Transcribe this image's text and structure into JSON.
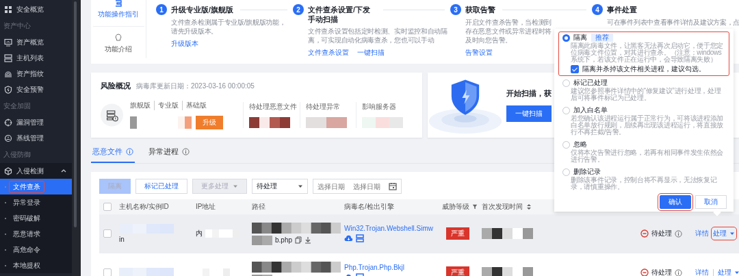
{
  "sidebar": {
    "items": [
      {
        "kind": "item",
        "label": "安全概览",
        "selected": false
      },
      {
        "kind": "section",
        "label": "资产中心"
      },
      {
        "kind": "item",
        "label": "资产概览",
        "selected": false
      },
      {
        "kind": "item",
        "label": "主机列表",
        "selected": false
      },
      {
        "kind": "item",
        "label": "资产指纹",
        "selected": false
      },
      {
        "kind": "item",
        "label": "安全预警",
        "selected": false
      },
      {
        "kind": "section",
        "label": "安全加固"
      },
      {
        "kind": "item",
        "label": "漏洞管理",
        "selected": false
      },
      {
        "kind": "item",
        "label": "基线管理",
        "selected": false
      },
      {
        "kind": "section",
        "label": "入侵防御"
      },
      {
        "kind": "group",
        "label": "入侵检测",
        "expanded": true,
        "children": [
          {
            "label": "文件查杀",
            "selected": true,
            "highlighted": true
          },
          {
            "label": "异常登录",
            "selected": false,
            "highlighted": false
          },
          {
            "label": "密码破解",
            "selected": false,
            "highlighted": false
          },
          {
            "label": "恶意请求",
            "selected": false,
            "highlighted": false
          },
          {
            "label": "高危命令",
            "selected": false,
            "highlighted": false
          },
          {
            "label": "本地提权",
            "selected": false,
            "highlighted": false
          }
        ]
      }
    ]
  },
  "guide": {
    "items": [
      {
        "label": "功能操作指引",
        "selected": true
      },
      {
        "label": "功能介绍",
        "selected": false
      }
    ]
  },
  "steps": [
    {
      "number": "1",
      "title": "升级专业版/旗舰版",
      "description": "文件查杀检测属于专业版/旗舰版功能，请先升级版本。",
      "links": [
        "升级版本"
      ]
    },
    {
      "number": "2",
      "title": "文件查杀设置/下发手动扫描",
      "description": "文件查杀设置包括定时检测、实时监控和自动隔离，可实现自动化病毒查杀，您也可以手动",
      "links": [
        "文件查杀设置",
        "一键扫描"
      ]
    },
    {
      "number": "3",
      "title": "获取告警",
      "description": "开启文件查杀告警，当检测到存在恶意文件或异常进程时将及时向您告警。",
      "links": [
        "告警设置"
      ]
    },
    {
      "number": "4",
      "title": "事件处置",
      "description": "可在事件列表中查看事件详情及建议方案，点"
    }
  ],
  "risk_overview": {
    "title": "风险概况",
    "update_date": "病毒库更新日期：2023-03-16 00:00:05",
    "editions": [
      "旗舰版",
      "专业版",
      "基础版"
    ],
    "upgrade_button": "升级",
    "stats": [
      "待处理恶意文件",
      "待处理异常",
      "影响服务器"
    ]
  },
  "scan_card": {
    "title": "开始扫描，获",
    "button": "一键扫描"
  },
  "tabs": [
    {
      "label": "恶意文件",
      "selected": true
    },
    {
      "label": "异常进程",
      "selected": false
    }
  ],
  "toolbar": {
    "isolate_button": {
      "label": "隔离",
      "disabled": true
    },
    "mark_button": {
      "label": "标记已处理",
      "disabled": false
    },
    "more_button": {
      "label": "更多处理",
      "disabled": true
    },
    "status_select": "待处理",
    "date_start": {
      "placeholder": "选择日期"
    },
    "date_end": {
      "placeholder": "选择日期"
    }
  },
  "table": {
    "select_all": {
      "checked": false
    },
    "columns": [
      {
        "label": "主机名称/实例ID",
        "kind": "plain"
      },
      {
        "label": "IP地址",
        "kind": "plain"
      },
      {
        "label": "路径",
        "kind": "plain"
      },
      {
        "label": "病毒名/检出引擎",
        "kind": "plain"
      },
      {
        "label": "威胁等级",
        "kind": "filter"
      },
      {
        "label": "首次发现时间",
        "kind": "sort"
      }
    ],
    "rows": [
      {
        "checked": false,
        "hovered": true,
        "host": "in",
        "ip": "内",
        "path": "b.php",
        "virus": "Win32.Trojan.Webshell.Simw",
        "threat": "严重",
        "status": "待处理",
        "details": "详情",
        "action": "处理",
        "action_highlighted": true
      },
      {
        "checked": false,
        "hovered": false,
        "virus": "Php.Trojan.Php.Bkjl",
        "threat": "严重",
        "status": "待处理",
        "details": "详情",
        "action": "处理",
        "action_highlighted": false
      }
    ]
  },
  "popup": {
    "options": [
      {
        "label": "隔离",
        "selected": true,
        "tag": "推荐",
        "highlighted": true,
        "description": "隔离此病毒文件，让黑客无法再次启动它，便于您定位病毒文件位置，对其进行查杀。（注意：windows系统下，若该文件正在运行中，会导致隔离失败）",
        "checkbox": {
          "label": "隔离并杀掉该文件相关进程，建议勾选。",
          "checked": true
        }
      },
      {
        "label": "标记已处理",
        "selected": false,
        "highlighted": false,
        "description": "建议您参照事件详情中的“修复建议”进行处理，处理后可将事件标记为已处理。"
      },
      {
        "label": "加入白名单",
        "selected": false,
        "highlighted": false,
        "description": "若您确认该进程运行属于正常行为，可将该进程添加白名单放行规则，后续再出现该进程运行，将直接放行不再拦截/告警。"
      },
      {
        "label": "忽略",
        "selected": false,
        "highlighted": false,
        "description": "仅将本次告警进行忽略，若再有相同事件发生依然会进行告警。"
      },
      {
        "label": "删除记录",
        "selected": false,
        "highlighted": false,
        "description": "删除该事件记录，控制台将不再显示，无法恢复记录，请慎重操作。"
      }
    ],
    "confirm_button": {
      "label": "确认",
      "highlighted": true
    },
    "cancel_button": "取消"
  }
}
